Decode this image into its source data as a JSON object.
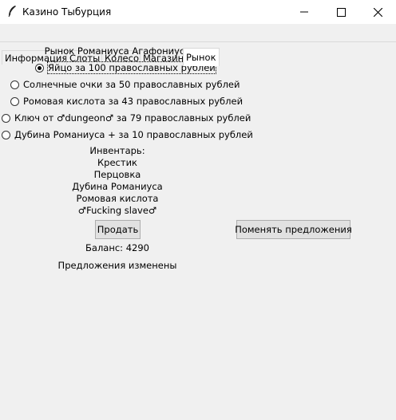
{
  "window": {
    "title": "Казино Тыбурция"
  },
  "tabs": [
    "Информация",
    "Слоты",
    "Колесо",
    "Магазин",
    "Рынок"
  ],
  "market": {
    "header": "Рынок Романиуса Агафониуса",
    "offers": [
      "Яйцо за 100 православных рублей",
      "Солнечные очки за 50 православных рублей",
      "Ромовая кислота за 43 православных рублей",
      "Ключ от ♂dungeon♂ за 79 православных рублей",
      "Дубина Романиуса + за 10 православных рублей"
    ],
    "selected_index": 0,
    "inventory_label": "Инвентарь:",
    "inventory": [
      "Крестик",
      "Перцовка",
      "Дубина Романиуса",
      "Ромовая кислота",
      "♂Fucking slave♂"
    ],
    "sell_label": "Продать",
    "change_offers_label": "Поменять предложения",
    "balance": "Баланс: 4290",
    "status": "Предложения изменены"
  }
}
